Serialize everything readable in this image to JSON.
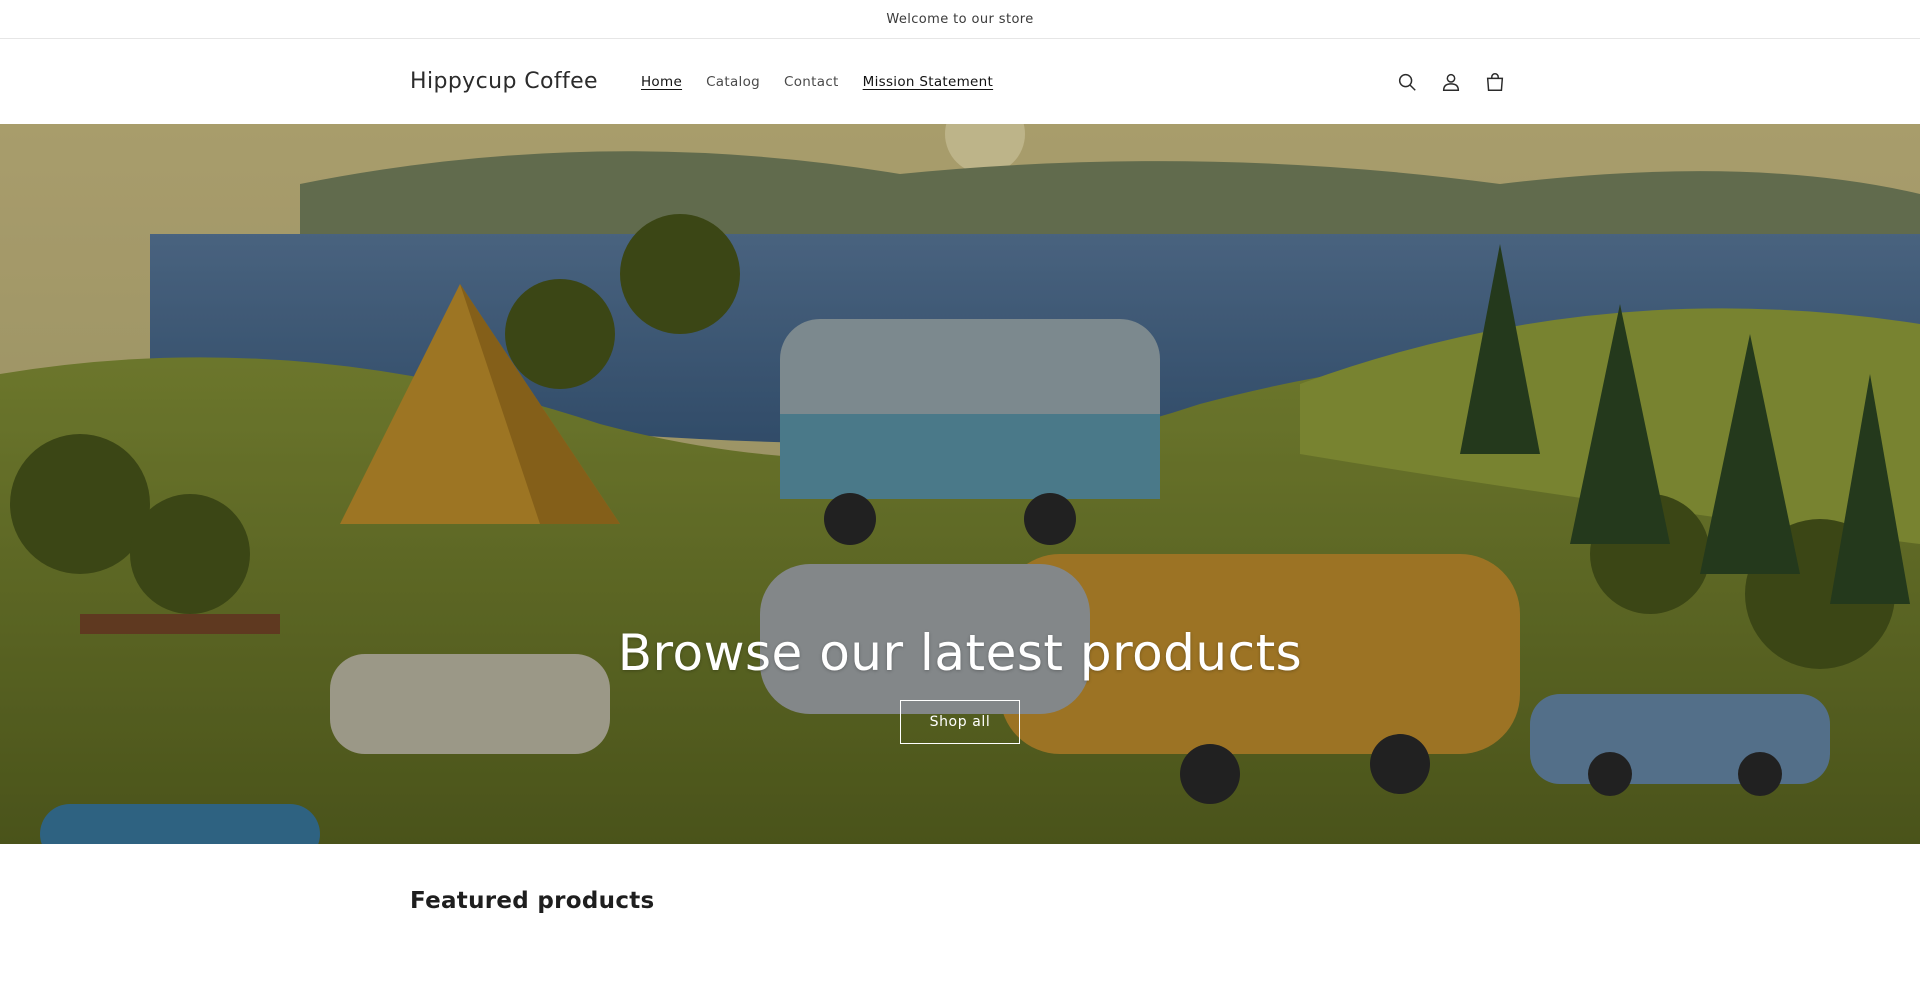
{
  "announcement": {
    "text": "Welcome to our store"
  },
  "header": {
    "brand": "Hippycup Coffee",
    "nav": [
      {
        "label": "Home"
      },
      {
        "label": "Catalog"
      },
      {
        "label": "Contact"
      },
      {
        "label": "Mission Statement"
      }
    ],
    "icons": [
      "search-icon",
      "account-icon",
      "cart-icon"
    ]
  },
  "hero": {
    "title": "Browse our latest products",
    "button_label": "Shop all"
  },
  "featured": {
    "heading": "Featured products"
  },
  "colors": {
    "text": "#121212",
    "background": "#ffffff",
    "hero_grass": "#6b7a2f",
    "hero_water": "#4a6f94"
  }
}
